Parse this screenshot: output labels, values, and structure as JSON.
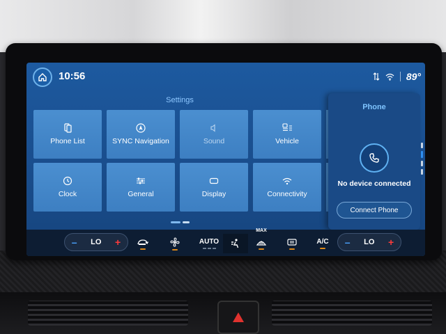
{
  "status": {
    "time": "10:56",
    "temperature": "89°",
    "icons": [
      "home-icon",
      "data-transfer-icon",
      "wifi-icon"
    ]
  },
  "settings": {
    "title": "Settings",
    "tiles": [
      {
        "label": "Phone List",
        "icon": "phone-list-icon"
      },
      {
        "label": "SYNC Navigation",
        "icon": "navigation-icon"
      },
      {
        "label": "Sound",
        "icon": "speaker-icon"
      },
      {
        "label": "Vehicle",
        "icon": "vehicle-icon"
      },
      {
        "label": "Clock",
        "icon": "clock-icon"
      },
      {
        "label": "General",
        "icon": "sliders-icon"
      },
      {
        "label": "Display",
        "icon": "display-icon"
      },
      {
        "label": "Connectivity",
        "icon": "connectivity-icon"
      }
    ],
    "pages": 2,
    "current_page": 1
  },
  "phone": {
    "title": "Phone",
    "status": "No device connected",
    "button": "Connect Phone"
  },
  "climate": {
    "left_temp": "LO",
    "right_temp": "LO",
    "minus": "–",
    "plus": "+",
    "auto_label": "AUTO",
    "max_label": "MAX",
    "ac_label": "A/C",
    "accent": "#e08a18"
  },
  "colors": {
    "screen_bg": "#1d5aa0",
    "tile_bg": "#4b8fd0",
    "accent_blue": "#8ec7ff"
  }
}
